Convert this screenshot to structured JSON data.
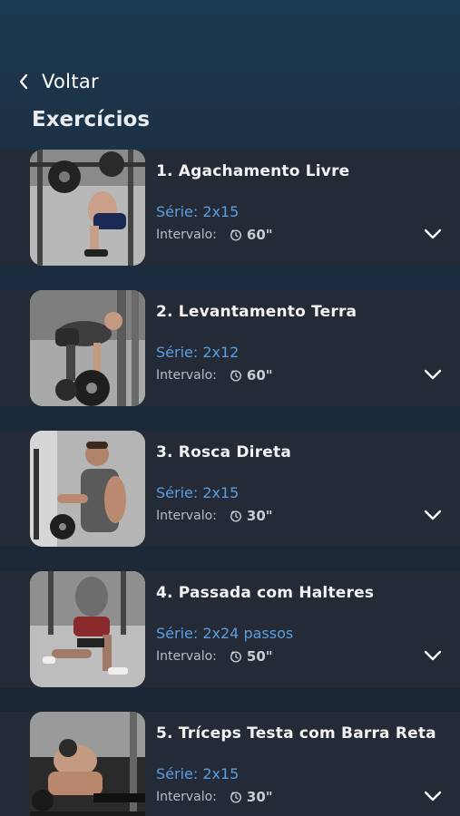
{
  "header": {
    "back_label": "Voltar",
    "title": "Exercícios"
  },
  "labels": {
    "interval": "Intervalo:"
  },
  "exercises": [
    {
      "name": "1. Agachamento Livre",
      "serie": "Série: 2x15",
      "time": "60\""
    },
    {
      "name": "2. Levantamento Terra",
      "serie": "Série: 2x12",
      "time": "60\""
    },
    {
      "name": "3. Rosca Direta",
      "serie": "Série: 2x15",
      "time": "30\""
    },
    {
      "name": "4. Passada com Halteres",
      "serie": "Série: 2x24 passos",
      "time": "50\""
    },
    {
      "name": "5. Tríceps Testa com Barra Reta",
      "serie": "Série: 2x15",
      "time": "30\""
    }
  ],
  "icons": {
    "back": "chevron-left-icon",
    "clock": "timer-icon",
    "expand": "chevron-down-icon"
  },
  "colors": {
    "accent": "#5b9fe0",
    "card": "#242a36"
  }
}
